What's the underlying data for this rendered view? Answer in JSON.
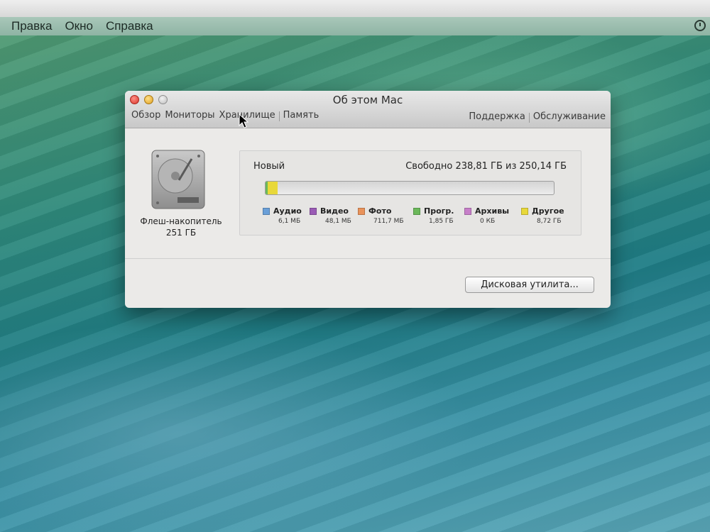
{
  "menubar": {
    "items": [
      "Правка",
      "Окно",
      "Справка"
    ]
  },
  "window": {
    "title": "Об этом Mac",
    "tabs_left": [
      "Обзор",
      "Мониторы",
      "Хранилище",
      "Память"
    ],
    "tabs_right": [
      "Поддержка",
      "Обслуживание"
    ]
  },
  "disk": {
    "name": "Флеш-накопитель",
    "size": "251 ГБ"
  },
  "storage": {
    "volume": "Новый",
    "free_text": "Свободно 238,81 ГБ из 250,14 ГБ",
    "used_fraction_other": 0.035,
    "used_fraction_apps": 0.008,
    "legend": [
      {
        "label": "Аудио",
        "size": "6,1 МБ",
        "color": "#6a9fd8"
      },
      {
        "label": "Видео",
        "size": "48,1 МБ",
        "color": "#9a5bb5"
      },
      {
        "label": "Фото",
        "size": "711,7 МБ",
        "color": "#e9925a"
      },
      {
        "label": "Прогр.",
        "size": "1,85 ГБ",
        "color": "#6bb85a"
      },
      {
        "label": "Архивы",
        "size": "0 КБ",
        "color": "#c77fc9"
      },
      {
        "label": "Другое",
        "size": "8,72 ГБ",
        "color": "#e8d83a"
      }
    ]
  },
  "buttons": {
    "disk_utility": "Дисковая утилита..."
  }
}
